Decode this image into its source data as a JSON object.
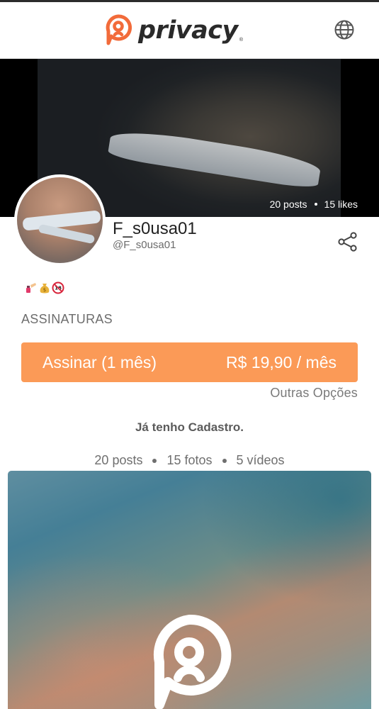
{
  "header": {
    "brand_name": "privacy",
    "brand_registered": "®",
    "brand_color": "#f26b3a",
    "language_icon": "globe-icon"
  },
  "cover": {
    "posts_label": "20 posts",
    "likes_label": "15 likes"
  },
  "profile": {
    "display_name": "F_s0usa01",
    "handle": "@F_s0usa01",
    "share_icon": "share-icon",
    "bio_emojis": [
      "nail-polish-emoji",
      "money-bag-emoji",
      "no-one-under-18-emoji"
    ]
  },
  "subscriptions": {
    "section_title": "ASSINATURAS",
    "subscribe_label": "Assinar (1 mês)",
    "subscribe_price": "R$ 19,90 / mês",
    "other_options": "Outras Opções",
    "accent_color": "#fb9a57"
  },
  "login": {
    "already_registered": "Já tenho Cadastro."
  },
  "stats": {
    "posts": "20 posts",
    "photos": "15 fotos",
    "videos": "5 vídeos"
  }
}
